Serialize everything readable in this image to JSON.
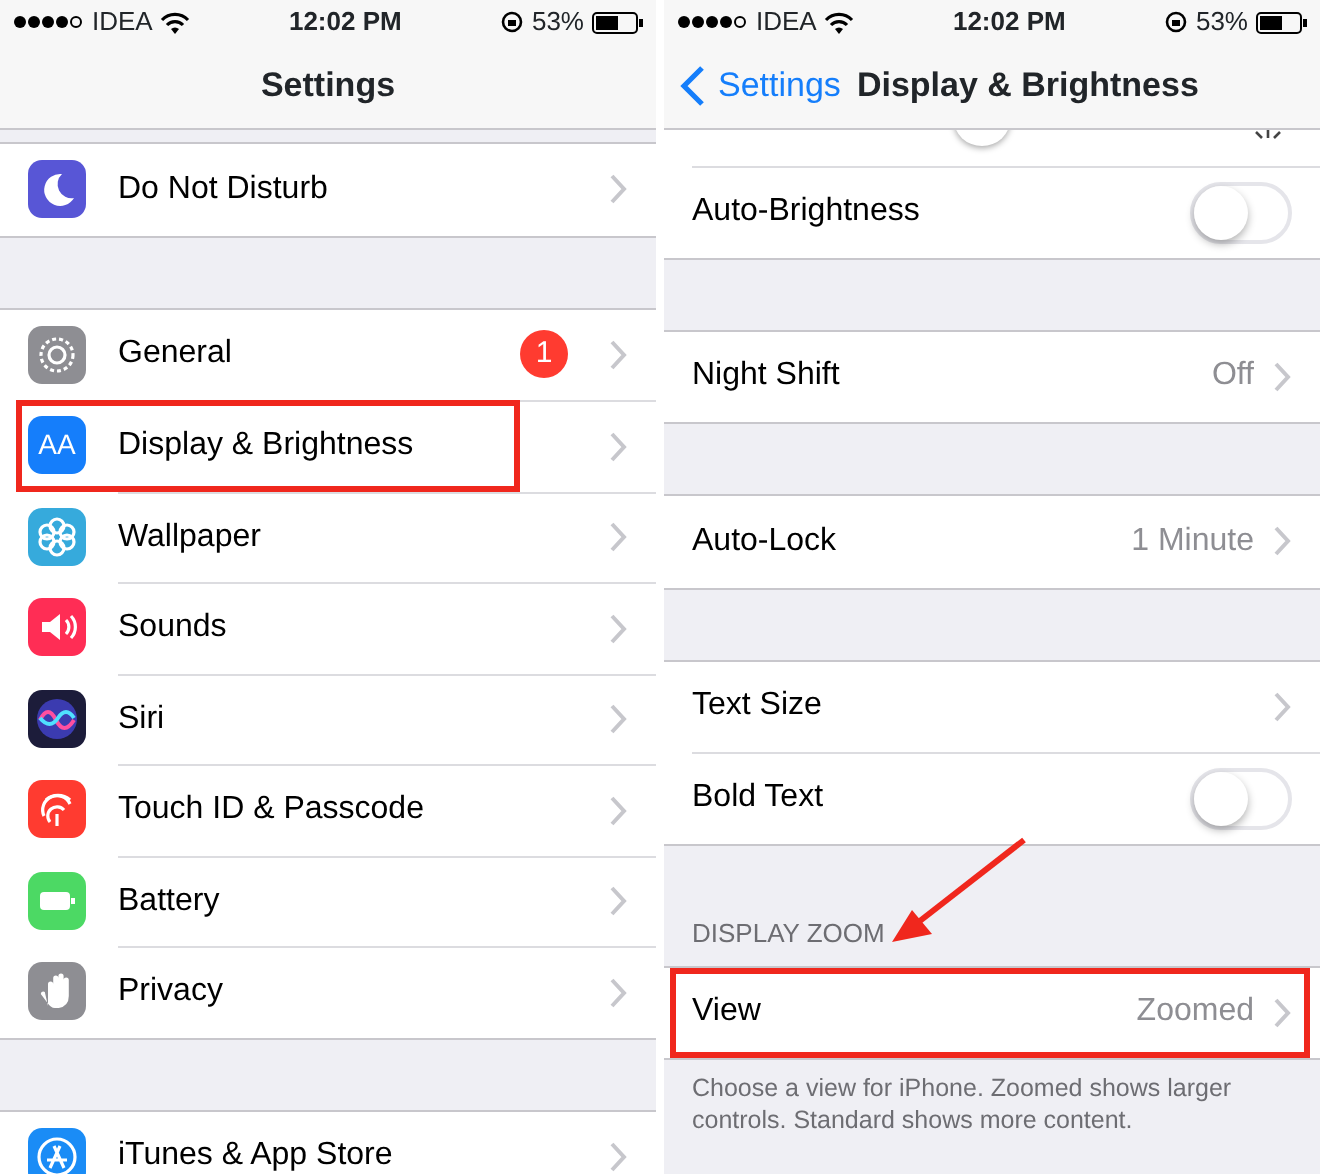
{
  "screens": [
    {
      "status_bar": {
        "carrier": "IDEA",
        "time": "12:02 PM",
        "battery": "53%"
      },
      "nav": {
        "title": "Settings"
      },
      "groups": [
        {
          "rows": [
            {
              "label": "Do Not Disturb",
              "kind": "link",
              "color": "#5856d6",
              "highlighted": false
            }
          ]
        },
        {
          "rows": [
            {
              "label": "General",
              "kind": "link",
              "color": "#8e8e93",
              "badge": "1",
              "highlighted": false
            },
            {
              "label": "Display & Brightness",
              "kind": "link",
              "color": "#157efb",
              "icon_text": "AA",
              "highlighted": true
            },
            {
              "label": "Wallpaper",
              "kind": "link",
              "color": "#36aadc",
              "highlighted": false
            },
            {
              "label": "Sounds",
              "kind": "link",
              "color": "#ff2d55",
              "highlighted": false
            },
            {
              "label": "Siri",
              "kind": "link",
              "color": "#1c1c3a",
              "highlighted": false
            },
            {
              "label": "Touch ID & Passcode",
              "kind": "link",
              "color": "#ff3b30",
              "highlighted": false
            },
            {
              "label": "Battery",
              "kind": "link",
              "color": "#4cd964",
              "highlighted": false
            },
            {
              "label": "Privacy",
              "kind": "link",
              "color": "#8e8e93",
              "highlighted": false
            }
          ]
        },
        {
          "rows": [
            {
              "label": "iTunes & App Store",
              "kind": "link",
              "color": "#1a8cf6",
              "highlighted": false
            }
          ]
        }
      ]
    },
    {
      "status_bar": {
        "carrier": "IDEA",
        "time": "12:02 PM",
        "battery": "53%"
      },
      "nav": {
        "back": "Settings",
        "title": "Display & Brightness"
      },
      "groups": [
        {
          "rows": [
            {
              "kind": "slider",
              "level": 0.5
            },
            {
              "label": "Auto-Brightness",
              "kind": "toggle",
              "on": false
            }
          ]
        },
        {
          "rows": [
            {
              "label": "Night Shift",
              "kind": "link",
              "value": "Off",
              "highlighted": false
            }
          ]
        },
        {
          "rows": [
            {
              "label": "Auto-Lock",
              "kind": "link",
              "value": "1 Minute",
              "highlighted": false
            }
          ]
        },
        {
          "rows": [
            {
              "label": "Text Size",
              "kind": "link",
              "highlighted": false
            },
            {
              "label": "Bold Text",
              "kind": "toggle",
              "on": false
            }
          ]
        },
        {
          "header": "DISPLAY ZOOM",
          "footer": "Choose a view for iPhone. Zoomed shows larger controls. Standard shows more content.",
          "rows": [
            {
              "label": "View",
              "kind": "link",
              "value": "Zoomed",
              "highlighted": true
            }
          ]
        }
      ]
    }
  ],
  "annotation": {
    "kind": "arrow"
  }
}
